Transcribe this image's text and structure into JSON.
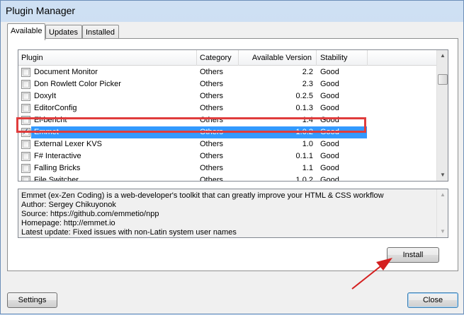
{
  "window": {
    "title": "Plugin Manager"
  },
  "tabs": [
    {
      "label": "Available",
      "active": true
    },
    {
      "label": "Updates",
      "active": false
    },
    {
      "label": "Installed",
      "active": false
    }
  ],
  "list": {
    "headers": {
      "plugin": "Plugin",
      "category": "Category",
      "version": "Available Version",
      "stability": "Stability"
    },
    "rows": [
      {
        "name": "Document Monitor",
        "category": "Others",
        "version": "2.2",
        "stability": "Good",
        "checked": false
      },
      {
        "name": "Don Rowlett Color Picker",
        "category": "Others",
        "version": "2.3",
        "stability": "Good",
        "checked": false
      },
      {
        "name": "DoxyIt",
        "category": "Others",
        "version": "0.2.5",
        "stability": "Good",
        "checked": false
      },
      {
        "name": "EditorConfig",
        "category": "Others",
        "version": "0.1.3",
        "stability": "Good",
        "checked": false
      },
      {
        "name": "Ei-bericht",
        "category": "Others",
        "version": "1.4",
        "stability": "Good",
        "checked": false
      },
      {
        "name": "Emmet",
        "category": "Others",
        "version": "1.0.2",
        "stability": "Good",
        "checked": true,
        "selected": true
      },
      {
        "name": "External Lexer KVS",
        "category": "Others",
        "version": "1.0",
        "stability": "Good",
        "checked": false
      },
      {
        "name": "F# Interactive",
        "category": "Others",
        "version": "0.1.1",
        "stability": "Good",
        "checked": false
      },
      {
        "name": "Falling Bricks",
        "category": "Others",
        "version": "1.1",
        "stability": "Good",
        "checked": false
      },
      {
        "name": "File Switcher",
        "category": "Others",
        "version": "1.0.2",
        "stability": "Good",
        "checked": false
      }
    ]
  },
  "description": [
    "Emmet (ex-Zen Coding) is a web-developer's toolkit that can greatly improve your HTML & CSS workflow",
    "Author: Sergey Chikuyonok",
    "Source: https://github.com/emmetio/npp",
    "Homepage: http://emmet.io",
    "Latest update: Fixed issues with non-Latin system user names"
  ],
  "buttons": {
    "install": "Install",
    "settings": "Settings",
    "close": "Close"
  },
  "colors": {
    "selection": "#3399ff",
    "highlight_box": "#e03c3c",
    "annotation_arrow": "#d42020"
  },
  "icons": {
    "checkbox_check": "✓",
    "scroll_up": "▲",
    "scroll_down": "▼"
  }
}
